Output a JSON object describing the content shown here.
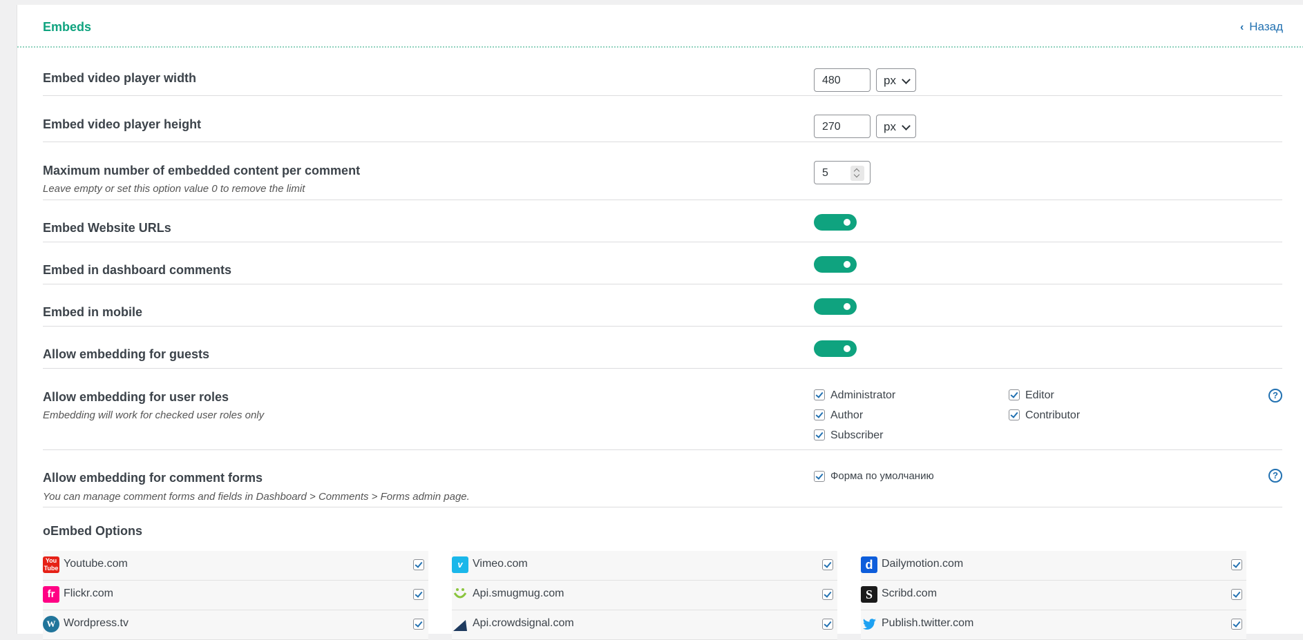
{
  "header": {
    "title": "Embeds",
    "back_label": "Назад"
  },
  "colors": {
    "accent": "#0fa37f",
    "link": "#2271b1"
  },
  "settings": {
    "width": {
      "label": "Embed video player width",
      "value": "480",
      "unit": "px"
    },
    "height": {
      "label": "Embed video player height",
      "value": "270",
      "unit": "px"
    },
    "max_embeds": {
      "label": "Maximum number of embedded content per comment",
      "description": "Leave empty or set this option value 0 to remove the limit",
      "value": "5"
    },
    "website_urls": {
      "label": "Embed Website URLs",
      "enabled": true
    },
    "dashboard": {
      "label": "Embed in dashboard comments",
      "enabled": true
    },
    "mobile": {
      "label": "Embed in mobile",
      "enabled": true
    },
    "guests": {
      "label": "Allow embedding for guests",
      "enabled": true
    },
    "user_roles": {
      "label": "Allow embedding for user roles",
      "description": "Embedding will work for checked user roles only",
      "roles": [
        {
          "name": "Administrator",
          "checked": true
        },
        {
          "name": "Editor",
          "checked": true
        },
        {
          "name": "Author",
          "checked": true
        },
        {
          "name": "Contributor",
          "checked": true
        },
        {
          "name": "Subscriber",
          "checked": true
        }
      ],
      "help": "?"
    },
    "comment_forms": {
      "label": "Allow embedding for comment forms",
      "description": "You can manage comment forms and fields in Dashboard > Comments > Forms admin page.",
      "forms": [
        {
          "name": "Форма по умолчанию",
          "checked": true
        }
      ],
      "help": "?"
    }
  },
  "oembed": {
    "title": "oEmbed Options",
    "providers": [
      {
        "name": "Youtube.com",
        "icon": "youtube-icon",
        "icon_text": "You Tube",
        "color": "#e62117",
        "checked": true
      },
      {
        "name": "Vimeo.com",
        "icon": "vimeo-icon",
        "icon_text": "v",
        "color": "#1ab7ea",
        "checked": true
      },
      {
        "name": "Dailymotion.com",
        "icon": "dailymotion-icon",
        "icon_text": "d",
        "color": "#0d5ddb",
        "checked": true
      },
      {
        "name": "Flickr.com",
        "icon": "flickr-icon",
        "icon_text": "fr",
        "color": "#ff0084",
        "checked": true
      },
      {
        "name": "Api.smugmug.com",
        "icon": "smugmug-icon",
        "icon_text": "",
        "color": "#8bc53f",
        "checked": true
      },
      {
        "name": "Scribd.com",
        "icon": "scribd-icon",
        "icon_text": "S",
        "color": "#1a1a1a",
        "checked": true
      },
      {
        "name": "Wordpress.tv",
        "icon": "wordpress-icon",
        "icon_text": "W",
        "color": "#21759b",
        "checked": true
      },
      {
        "name": "Api.crowdsignal.com",
        "icon": "crowdsignal-icon",
        "icon_text": "",
        "color": "#1e3a5f",
        "checked": true
      },
      {
        "name": "Publish.twitter.com",
        "icon": "twitter-icon",
        "icon_text": "",
        "color": "#1da1f2",
        "checked": true
      }
    ]
  }
}
